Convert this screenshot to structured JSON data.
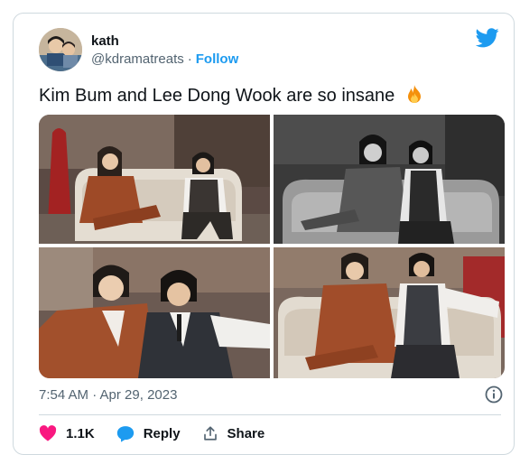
{
  "author": {
    "name": "kath",
    "handle": "@kdramatreats",
    "separator": "·",
    "follow_label": "Follow"
  },
  "tweet": {
    "text": "Kim Bum and Lee Dong Wook are so insane",
    "emoji_icon": "fire-icon",
    "timestamp": "7:54 AM · Apr 29, 2023"
  },
  "photos": [
    {
      "id": "photo-1",
      "style": "color",
      "backdrop": "#5b4a44"
    },
    {
      "id": "photo-2",
      "style": "black-and-white",
      "backdrop": "#3a3a3a"
    },
    {
      "id": "photo-3",
      "style": "color",
      "backdrop": "#6b5a52"
    },
    {
      "id": "photo-4",
      "style": "color",
      "backdrop": "#7a685e"
    }
  ],
  "actions": {
    "like_count": "1.1K",
    "reply_label": "Reply",
    "share_label": "Share"
  },
  "colors": {
    "brand": "#1d9bf0",
    "like": "#f91880",
    "muted": "#536471",
    "border": "#cfd9de"
  },
  "icons": [
    "twitter-bird-icon",
    "fire-icon",
    "info-icon",
    "heart-icon",
    "reply-bubble-icon",
    "share-icon"
  ]
}
